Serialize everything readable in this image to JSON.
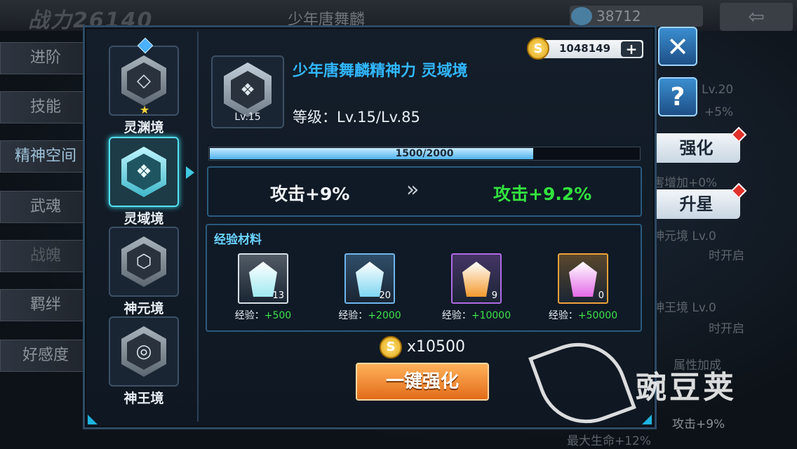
{
  "background": {
    "power_text": "战力26140",
    "hero_title": "少年唐舞麟",
    "currency_value": "38712",
    "back_icon": "back-arrow-icon",
    "side_tabs": [
      "进阶",
      "技能",
      "精神空间",
      "武魂",
      "战魄",
      "羁绊",
      "好感度"
    ],
    "right_texts": {
      "lv20": "Lv.20",
      "bonus": "+5%",
      "damage": "害增加+0%",
      "shen_yuan": "神元境 Lv.0",
      "shen_yuan_open": "时开启",
      "shen_wang": "神王境 Lv.0",
      "shen_wang_open": "时开启",
      "attr_add": "属性加成",
      "attack": "攻击+9%",
      "hp": "最大生命+12%"
    },
    "strengthen_label": "强化",
    "star_up_label": "升星"
  },
  "panel": {
    "tiers": [
      {
        "label": "灵渊境",
        "icon": "realm-abyss-icon",
        "glyph": "◇",
        "starred": true
      },
      {
        "label": "灵域境",
        "icon": "realm-domain-icon",
        "glyph": "❖",
        "active": true
      },
      {
        "label": "神元境",
        "icon": "realm-origin-icon",
        "glyph": "⬡"
      },
      {
        "label": "神王境",
        "icon": "realm-king-icon",
        "glyph": "◎"
      }
    ],
    "current": {
      "icon_glyph": "❖",
      "icon_level": "Lv.15",
      "title": "少年唐舞麟精神力 灵域境",
      "level_text": "等级：Lv.15/Lv.85"
    },
    "gold": {
      "amount": "1048149",
      "coin_symbol": "S",
      "plus_symbol": "+"
    },
    "exp": {
      "text": "1500/2000",
      "fraction": 0.75
    },
    "compare": {
      "from": "攻击+9%",
      "arrow": "»",
      "to": "攻击+9.2%"
    },
    "materials_title": "经验材料",
    "materials": [
      {
        "count": "13",
        "exp_label": "经验：",
        "exp_value": "+500",
        "frame": "#d7dee5",
        "crystal": "#9fe9f0"
      },
      {
        "count": "20",
        "exp_label": "经验：",
        "exp_value": "+2000",
        "frame": "#6fb6ef",
        "crystal": "#7fd6f2"
      },
      {
        "count": "9",
        "exp_label": "经验：",
        "exp_value": "+10000",
        "frame": "#b06ae5",
        "crystal": "#f39a2e"
      },
      {
        "count": "0",
        "exp_label": "经验：",
        "exp_value": "+50000",
        "frame": "#f0a13a",
        "crystal": "#e46ae8"
      }
    ],
    "cost": "x10500",
    "upgrade_label": "一键强化"
  },
  "buttons": {
    "close_symbol": "✕",
    "help_symbol": "?"
  },
  "watermark_text": "豌豆荚",
  "colors": {
    "title_blue": "#31b7ff",
    "value_green": "#33e23f",
    "accent_cyan": "#3fd7ea"
  }
}
